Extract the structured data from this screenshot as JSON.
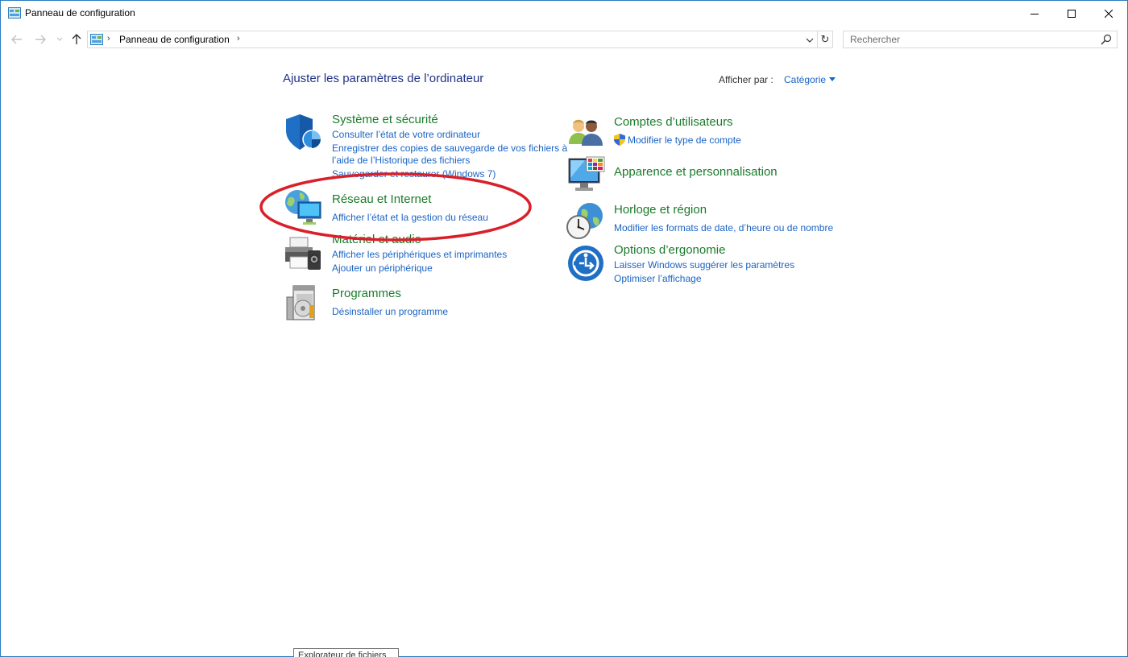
{
  "window": {
    "title": "Panneau de configuration"
  },
  "nav": {
    "breadcrumb": "Panneau de configuration",
    "search_placeholder": "Rechercher",
    "refresh_glyph": "↻"
  },
  "content": {
    "heading": "Ajuster les paramètres de l’ordinateur",
    "view_by_label": "Afficher par :",
    "view_by_value": "Catégorie"
  },
  "categories": {
    "system": {
      "title": "Système et sécurité",
      "links": [
        "Consulter l’état de votre ordinateur",
        "Enregistrer des copies de sauvegarde de vos fichiers à",
        "l’aide de l’Historique des fichiers",
        "Sauvegarder et restaurer (Windows 7)"
      ]
    },
    "network": {
      "title": "Réseau et Internet",
      "links": [
        "Afficher l’état et la gestion du réseau"
      ]
    },
    "hardware": {
      "title": "Matériel et audio",
      "links": [
        "Afficher les périphériques et imprimantes",
        "Ajouter un périphérique"
      ]
    },
    "programs": {
      "title": "Programmes",
      "links": [
        "Désinstaller un programme"
      ]
    },
    "accounts": {
      "title": "Comptes d’utilisateurs",
      "links": [
        "Modifier le type de compte"
      ]
    },
    "appearance": {
      "title": "Apparence et personnalisation",
      "links": []
    },
    "clock": {
      "title": "Horloge et région",
      "links": [
        "Modifier les formats de date, d’heure ou de nombre"
      ]
    },
    "ease": {
      "title": "Options d’ergonomie",
      "links": [
        "Laisser Windows suggérer les paramètres",
        "Optimiser l’affichage"
      ]
    }
  },
  "tooltip": {
    "text": "Explorateur de fichiers"
  },
  "colors": {
    "heading": "#1e3287",
    "category_title": "#1a7b2a",
    "link": "#1a64c4",
    "highlight": "#d9202a"
  },
  "icons": {
    "system": "shield-icon",
    "network": "network-globe-icon",
    "hardware": "printer-icon",
    "programs": "programs-disc-icon",
    "accounts": "users-icon",
    "appearance": "monitor-palette-icon",
    "clock": "clock-globe-icon",
    "ease": "ease-of-access-icon"
  }
}
